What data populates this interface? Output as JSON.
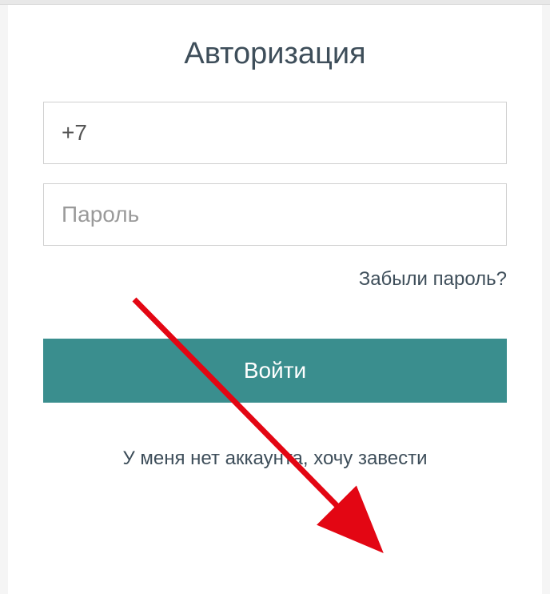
{
  "title": "Авторизация",
  "phone": {
    "value": "+7",
    "placeholder": ""
  },
  "password": {
    "value": "",
    "placeholder": "Пароль"
  },
  "forgot_link": "Забыли пароль?",
  "login_button": "Войти",
  "register_link": "У меня нет аккаунта, хочу завести",
  "colors": {
    "accent": "#3a8e8e",
    "text_dark": "#3e4e5a",
    "arrow": "#e30613"
  }
}
